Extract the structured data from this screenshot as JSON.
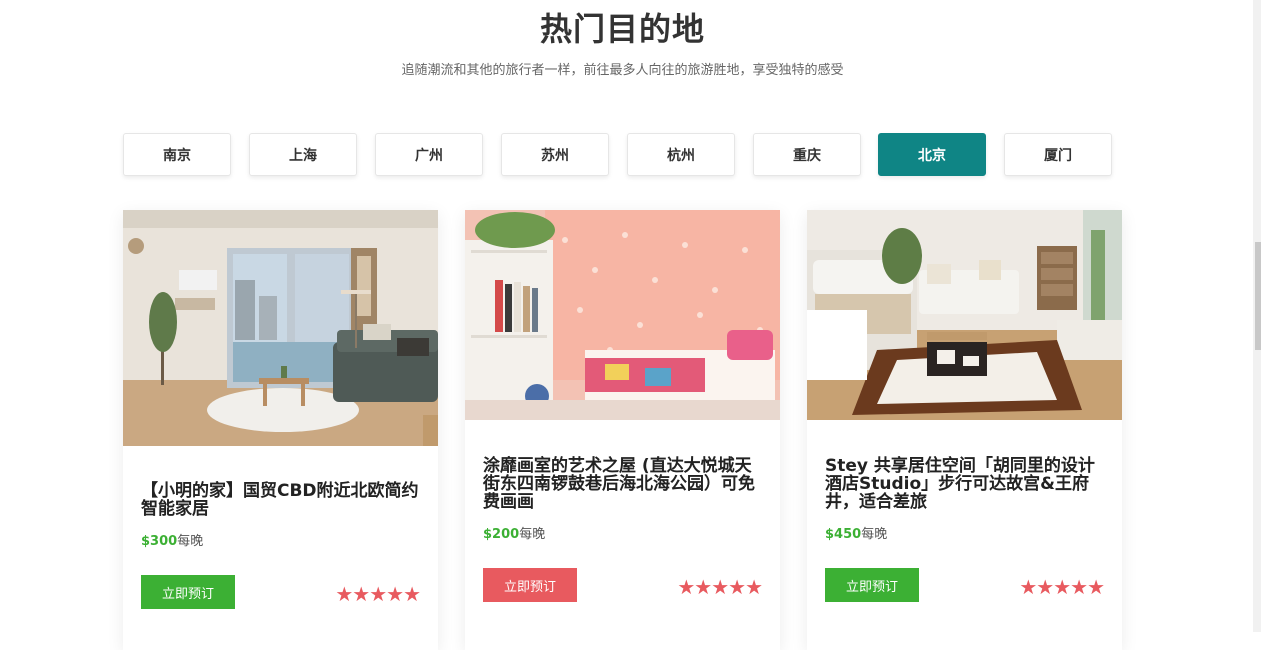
{
  "section": {
    "title": "热门目的地",
    "subtitle": "追随潮流和其他的旅行者一样，前往最多人向往的旅游胜地，享受独特的感受"
  },
  "tabs": [
    {
      "label": "南京",
      "active": false
    },
    {
      "label": "上海",
      "active": false
    },
    {
      "label": "广州",
      "active": false
    },
    {
      "label": "苏州",
      "active": false
    },
    {
      "label": "杭州",
      "active": false
    },
    {
      "label": "重庆",
      "active": false
    },
    {
      "label": "北京",
      "active": true
    },
    {
      "label": "厦门",
      "active": false
    }
  ],
  "cards": [
    {
      "title": "【小明的家】国贸CBD附近北欧简约智能家居",
      "price": "$300",
      "unit": "每晚",
      "button": "立即预订",
      "stars": "★★★★★",
      "rating": 5
    },
    {
      "title": "涂靡画室的艺术之屋 (直达大悦城天街东四南锣鼓巷后海北海公园）可免费画画",
      "price": "$200",
      "unit": "每晚",
      "button": "立即预订",
      "stars": "★★★★★",
      "rating": 5
    },
    {
      "title": "Stey 共享居住空间「胡同里的设计酒店Studio」步行可达故宫&王府井，适合差旅",
      "price": "$450",
      "unit": "每晚",
      "button": "立即预订",
      "stars": "★★★★★",
      "rating": 5
    }
  ],
  "colors": {
    "active_tab": "#0f8585",
    "price": "#3cb034",
    "button_green": "#3cb034",
    "button_red": "#e85a5f",
    "stars": "#e85a5f"
  }
}
